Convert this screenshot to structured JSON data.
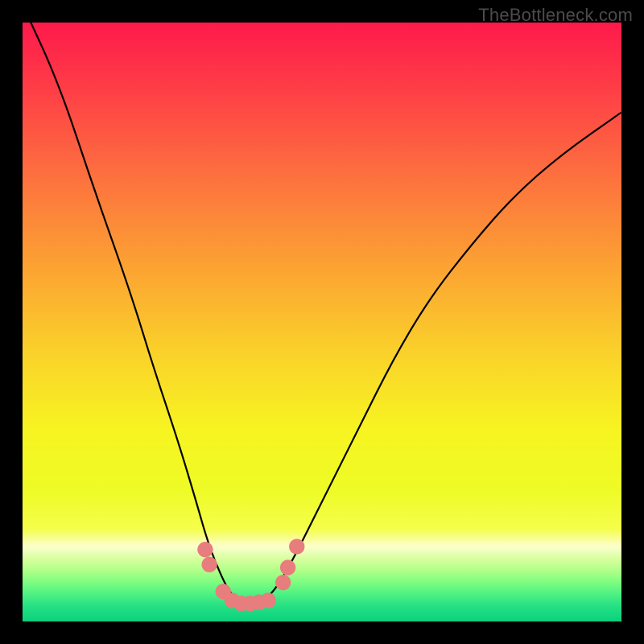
{
  "watermark": "TheBottleneck.com",
  "chart_data": {
    "type": "line",
    "title": "",
    "xlabel": "",
    "ylabel": "",
    "xlim": [
      0,
      100
    ],
    "ylim": [
      0,
      100
    ],
    "series": [
      {
        "name": "curve",
        "x": [
          0,
          6,
          12,
          18,
          22,
          26,
          29,
          31,
          33,
          34.5,
          36,
          38,
          40,
          42,
          45,
          50,
          56,
          62,
          68,
          75,
          82,
          90,
          100
        ],
        "y": [
          103,
          90,
          72,
          55,
          42,
          30,
          20,
          13,
          8,
          5,
          3.5,
          3,
          3.5,
          5,
          10,
          20,
          32,
          44,
          54,
          63,
          71,
          78,
          85
        ]
      }
    ],
    "markers": {
      "name": "rising-markers",
      "color": "#e77d7d",
      "points": [
        {
          "x": 30.5,
          "y": 12.0,
          "r": 1.3
        },
        {
          "x": 31.2,
          "y": 9.5,
          "r": 1.3
        },
        {
          "x": 33.5,
          "y": 5.0,
          "r": 1.3
        },
        {
          "x": 35.0,
          "y": 3.5,
          "r": 1.3
        },
        {
          "x": 36.5,
          "y": 3.0,
          "r": 1.3
        },
        {
          "x": 38.0,
          "y": 3.0,
          "r": 1.3
        },
        {
          "x": 39.5,
          "y": 3.2,
          "r": 1.3
        },
        {
          "x": 41.0,
          "y": 3.5,
          "r": 1.3
        },
        {
          "x": 43.5,
          "y": 6.5,
          "r": 1.3
        },
        {
          "x": 44.3,
          "y": 9.0,
          "r": 1.3
        },
        {
          "x": 45.8,
          "y": 12.5,
          "r": 1.3
        }
      ]
    },
    "gradient_stops": [
      {
        "offset": 0.0,
        "color": "#fe1a4b"
      },
      {
        "offset": 0.1,
        "color": "#fe3a47"
      },
      {
        "offset": 0.25,
        "color": "#fd6e3f"
      },
      {
        "offset": 0.4,
        "color": "#fca033"
      },
      {
        "offset": 0.55,
        "color": "#fad12a"
      },
      {
        "offset": 0.68,
        "color": "#f7f421"
      },
      {
        "offset": 0.78,
        "color": "#eefb26"
      },
      {
        "offset": 0.845,
        "color": "#f5fe4a"
      },
      {
        "offset": 0.875,
        "color": "#fbffce"
      },
      {
        "offset": 0.895,
        "color": "#d8ff9e"
      },
      {
        "offset": 0.915,
        "color": "#b0ff88"
      },
      {
        "offset": 0.935,
        "color": "#7cfd80"
      },
      {
        "offset": 0.955,
        "color": "#4df083"
      },
      {
        "offset": 0.975,
        "color": "#25e084"
      },
      {
        "offset": 1.0,
        "color": "#0ad17d"
      }
    ]
  }
}
